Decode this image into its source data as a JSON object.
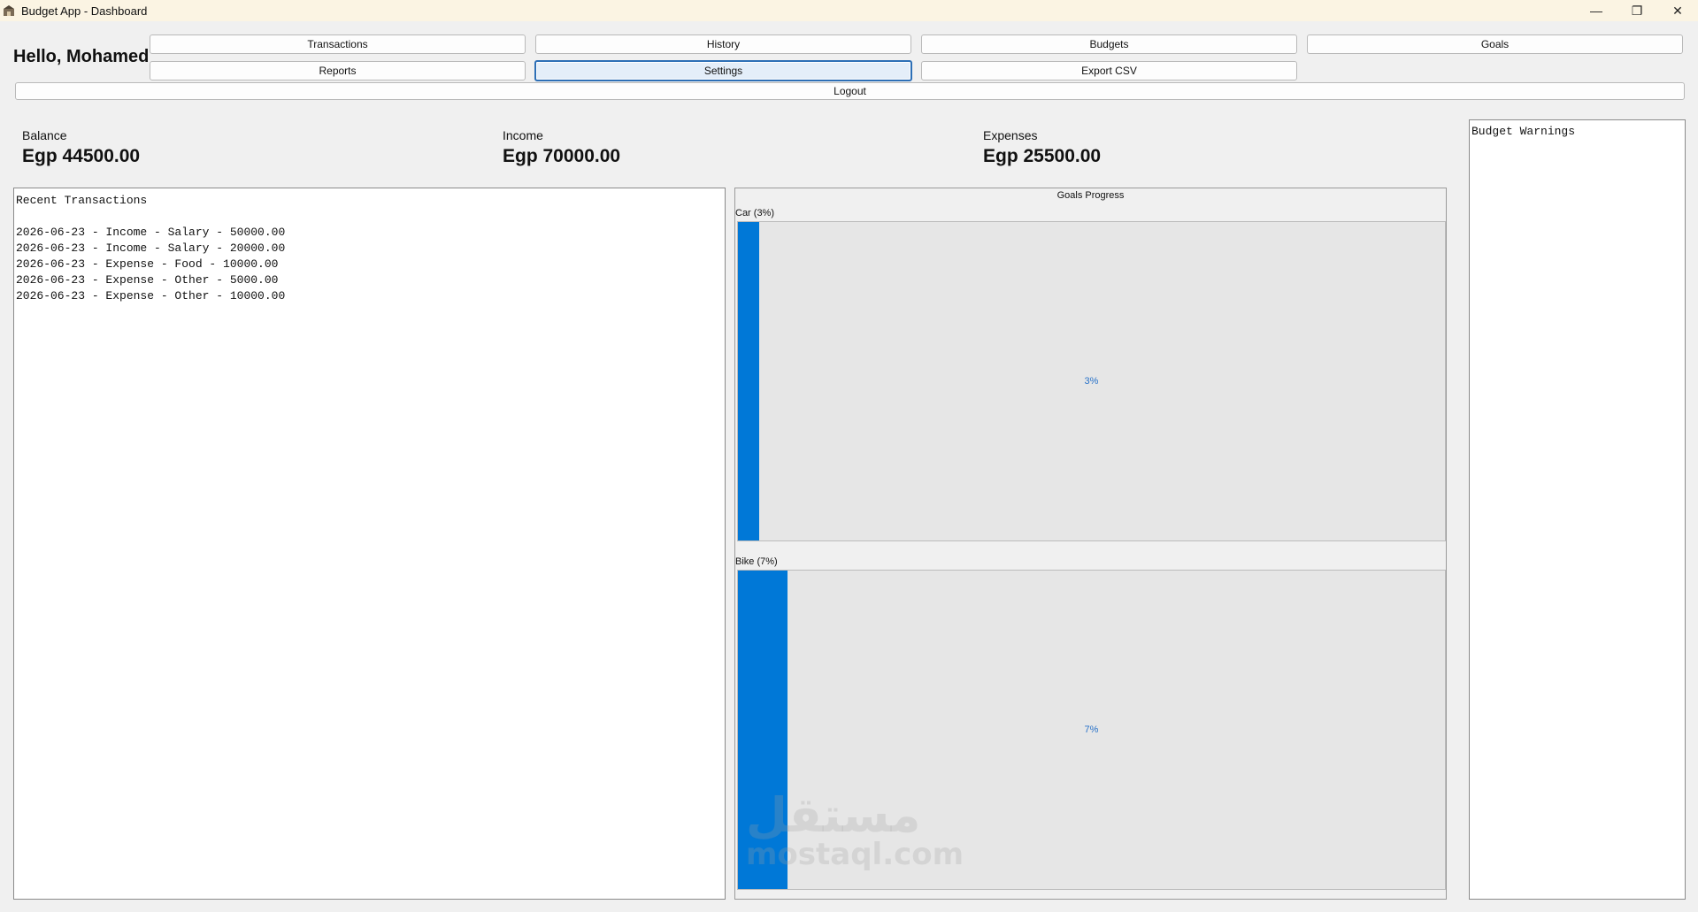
{
  "window": {
    "title": "Budget App - Dashboard",
    "controls": {
      "minimize": "—",
      "restore": "❐",
      "close": "✕"
    }
  },
  "header": {
    "greeting": "Hello, Mohamed"
  },
  "nav": {
    "transactions": "Transactions",
    "history": "History",
    "budgets": "Budgets",
    "goals": "Goals",
    "reports": "Reports",
    "settings": "Settings",
    "export_csv": "Export CSV",
    "logout": "Logout"
  },
  "summary": {
    "balance": {
      "label": "Balance",
      "value": "Egp 44500.00"
    },
    "income": {
      "label": "Income",
      "value": "Egp 70000.00"
    },
    "expenses": {
      "label": "Expenses",
      "value": "Egp 25500.00"
    }
  },
  "recent_transactions": {
    "title": "Recent Transactions",
    "items": [
      "2026-06-23 - Income - Salary - 50000.00",
      "2026-06-23 - Income - Salary - 20000.00",
      "2026-06-23 - Expense - Food - 10000.00",
      "2026-06-23 - Expense - Other - 5000.00",
      "2026-06-23 - Expense - Other - 10000.00"
    ]
  },
  "goals_progress": {
    "title": "Goals Progress",
    "goals": [
      {
        "label": "Car (3%)",
        "percent_text": "3%",
        "progress": 3
      },
      {
        "label": "Bike (7%)",
        "percent_text": "7%",
        "progress": 7
      }
    ],
    "fill_color": "#0078d7",
    "percent_text_color": "#2a73c9"
  },
  "budget_warnings": {
    "title": "Budget Warnings"
  },
  "watermark": {
    "arabic": "مستقل",
    "latin": "mostaql.com"
  }
}
